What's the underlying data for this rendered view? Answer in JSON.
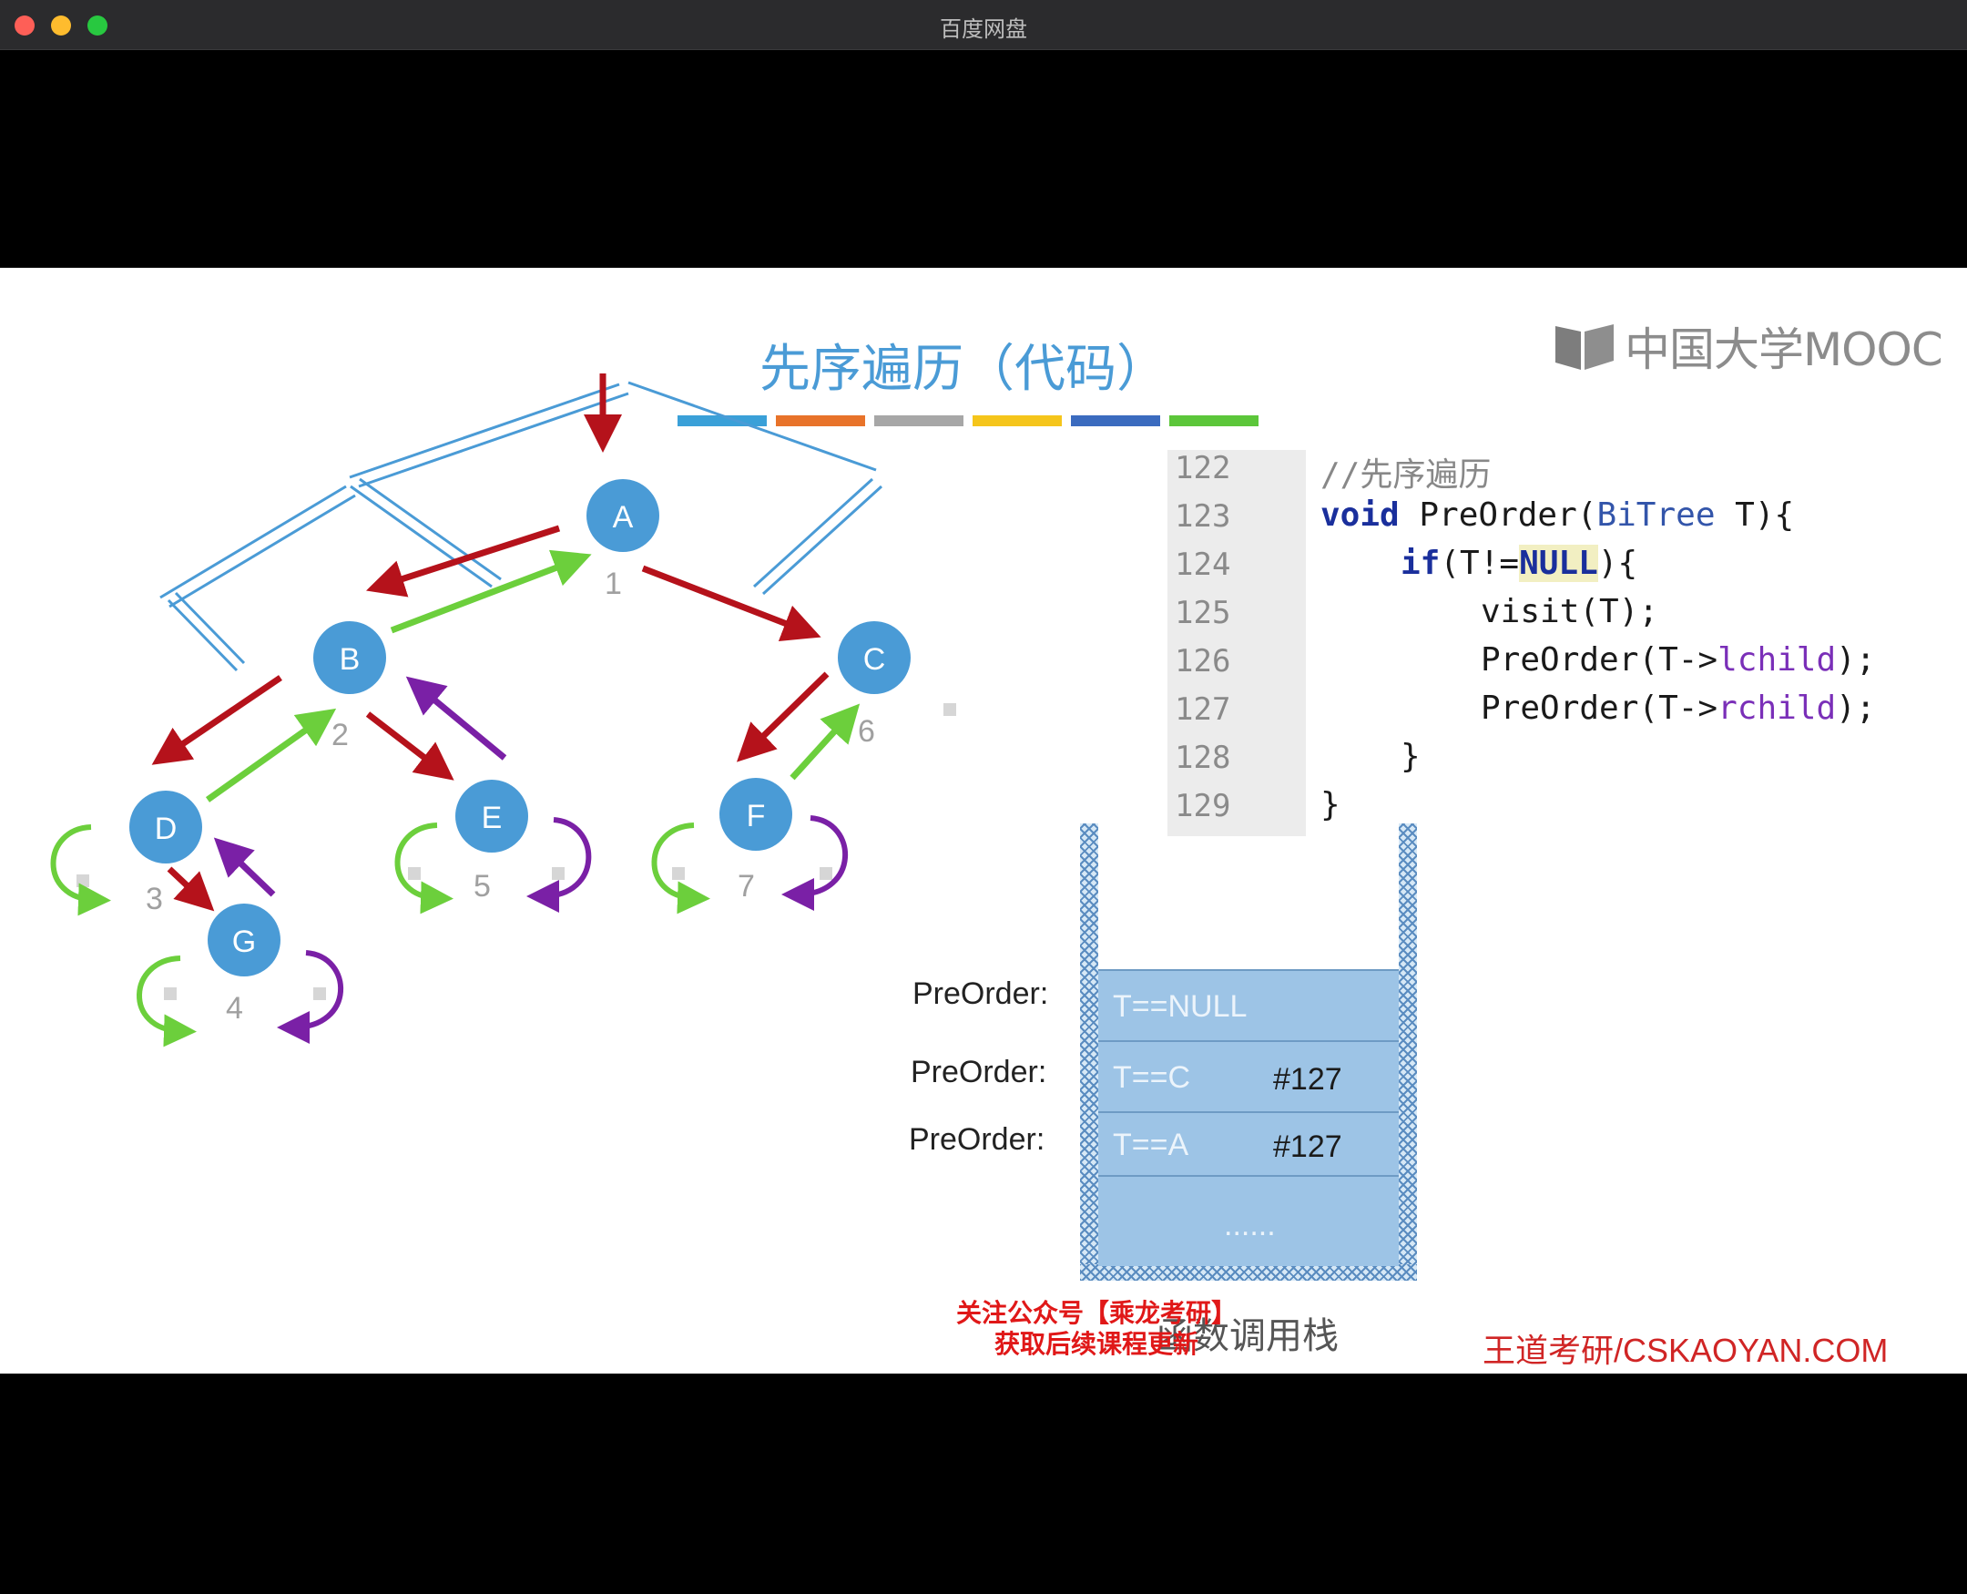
{
  "window": {
    "title": "百度网盘"
  },
  "slide": {
    "title": "先序遍历（代码）",
    "bar_colors": [
      "#3aa0d8",
      "#e8732a",
      "#a7a7a7",
      "#f5c51b",
      "#3b6bbf",
      "#5cc63a"
    ],
    "logo_text": "中国大学MOOC",
    "watermark": "王道考研/CSKAOYAN.COM",
    "promo_line1": "关注公众号【乘龙考研】",
    "promo_line2": "获取后续课程更新"
  },
  "tree": {
    "nodes": [
      "A",
      "B",
      "C",
      "D",
      "E",
      "F",
      "G"
    ],
    "step_labels": [
      "1",
      "2",
      "3",
      "4",
      "5",
      "6",
      "7"
    ]
  },
  "code": {
    "line_numbers": [
      "122",
      "123",
      "124",
      "125",
      "126",
      "127",
      "128",
      "129"
    ],
    "comment": "//先序遍历",
    "l123_kw": "void",
    "l123_rest1": " PreOrder(",
    "l123_type": "BiTree",
    "l123_rest2": " T){",
    "l124_kw": "if",
    "l124_rest1": "(T!=",
    "l124_null": "NULL",
    "l124_rest2": "){",
    "l125": "visit(T);",
    "l126_a": "PreOrder(T->",
    "l126_field": "lchild",
    "l126_b": ");",
    "l127_a": "PreOrder(T->",
    "l127_field": "rchild",
    "l127_b": ");",
    "l128": "}",
    "l129": "}"
  },
  "stack": {
    "caption": "函数调用栈",
    "frames": [
      {
        "label": "PreOrder:",
        "state": "T==NULL",
        "ret": ""
      },
      {
        "label": "PreOrder:",
        "state": "T==C",
        "ret": "#127"
      },
      {
        "label": "PreOrder:",
        "state": "T==A",
        "ret": "#127"
      }
    ],
    "bottom": "......"
  }
}
